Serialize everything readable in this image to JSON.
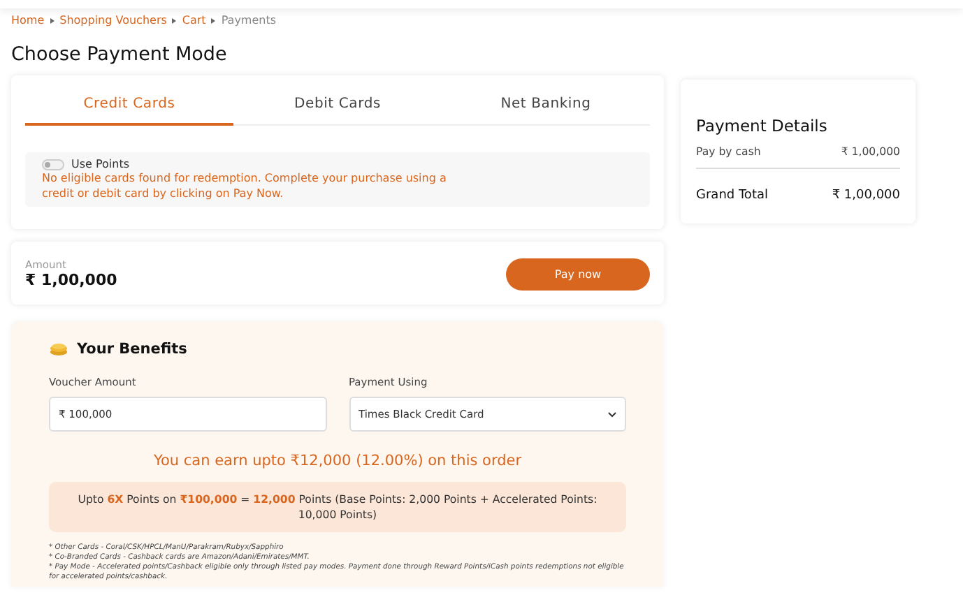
{
  "breadcrumb": [
    {
      "label": "Home",
      "current": false
    },
    {
      "label": "Shopping Vouchers",
      "current": false
    },
    {
      "label": "Cart",
      "current": false
    },
    {
      "label": "Payments",
      "current": true
    }
  ],
  "title": "Choose Payment Mode",
  "tabs": [
    {
      "label": "Credit Cards",
      "selected": true
    },
    {
      "label": "Debit Cards",
      "selected": false
    },
    {
      "label": "Net Banking",
      "selected": false
    }
  ],
  "use_points": {
    "label": "Use Points",
    "on": false,
    "message": "No eligible cards found for redemption. Complete your purchase using a credit or debit card by clicking on Pay Now."
  },
  "amount": {
    "label": "Amount",
    "value": "₹ 1,00,000",
    "button": "Pay now"
  },
  "benefits": {
    "title": "Your Benefits",
    "voucher_label": "Voucher Amount",
    "voucher_value": "₹ 100,000",
    "payment_label": "Payment Using",
    "payment_value": "Times Black Credit Card",
    "earn": "You can earn upto ₹12,000 (12.00%) on this order",
    "points": "Upto **6X** Points on **₹100,000** = **12,000** Points (Base Points: 2,000 Points + Accelerated Points: 10,000 Points)",
    "notes": [
      "* Other Cards - Coral/CSK/HPCL/ManU/Parakram/Rubyx/Sapphiro",
      "* Co-Branded Cards - Cashback cards are Amazon/Adani/Emirates/MMT.",
      "* Pay Mode - Accelerated points/Cashback eligible only through listed pay modes. Payment done through Reward Points/iCash points redemptions not eligible for accelerated points/cashback."
    ]
  },
  "details": {
    "title": "Payment Details",
    "rows": [
      {
        "label": "Pay by cash",
        "value": "₹ 1,00,000"
      }
    ],
    "total_label": "Grand Total",
    "total_value": "₹ 1,00,000"
  }
}
